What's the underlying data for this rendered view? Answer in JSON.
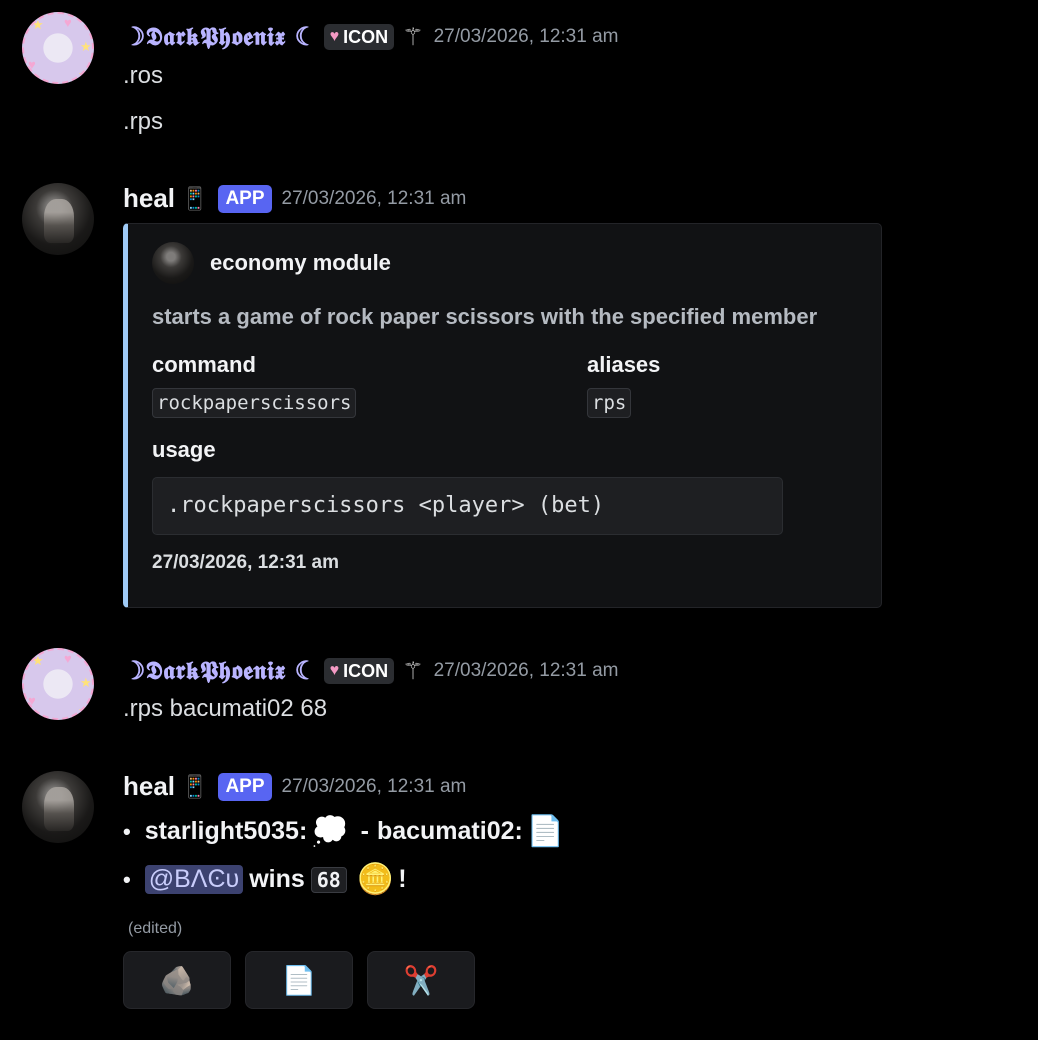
{
  "messages": [
    {
      "author": "☽𝕯𝖆𝖗𝖐𝕻𝖍𝖔𝖊𝖓𝖎𝖝 ☾",
      "tag": "ICON",
      "tag_icon": "heart-icon",
      "wand_icon": "wand-icon",
      "timestamp": "27/03/2026, 12:31 am",
      "lines": [
        ".ros",
        ".rps"
      ]
    },
    {
      "author": "heal",
      "badge": "APP",
      "timestamp": "27/03/2026, 12:31 am",
      "embed": {
        "accent": "#a0cbf7",
        "author": "economy module",
        "description": "starts a game of rock paper scissors with the specified member",
        "fields": [
          {
            "name": "command",
            "value": "rockpaperscissors"
          },
          {
            "name": "aliases",
            "value": "rps"
          },
          {
            "name": "usage",
            "value": ".rockpaperscissors <player> (bet)"
          }
        ],
        "footer": "27/03/2026, 12:31 am"
      }
    },
    {
      "author": "☽𝕯𝖆𝖗𝖐𝕻𝖍𝖔𝖊𝖓𝖎𝖝 ☾",
      "tag": "ICON",
      "timestamp": "27/03/2026, 12:31 am",
      "lines": [
        ".rps bacumati02 68"
      ]
    },
    {
      "author": "heal",
      "badge": "APP",
      "timestamp": "27/03/2026, 12:31 am",
      "bullets": [
        {
          "p1": "starlight5035:",
          "e1": "💭",
          "sep": "-",
          "p2": "bacumati02:",
          "e2": "📄"
        },
        {
          "mention": "@BΛϾᴜ",
          "wins": "wins",
          "amount": "68",
          "coin": "🪙",
          "end": "!"
        }
      ],
      "edited": "(edited)",
      "buttons": [
        {
          "icon": "rock-icon",
          "glyph": "🪨"
        },
        {
          "icon": "paper-icon",
          "glyph": "📄"
        },
        {
          "icon": "scissors-icon",
          "glyph": "✂️"
        }
      ]
    }
  ],
  "colors": {
    "background": "#000000",
    "app_badge": "#5865f2",
    "name_phoenix": "#b9b4ff",
    "mention_bg": "#3c4270"
  }
}
